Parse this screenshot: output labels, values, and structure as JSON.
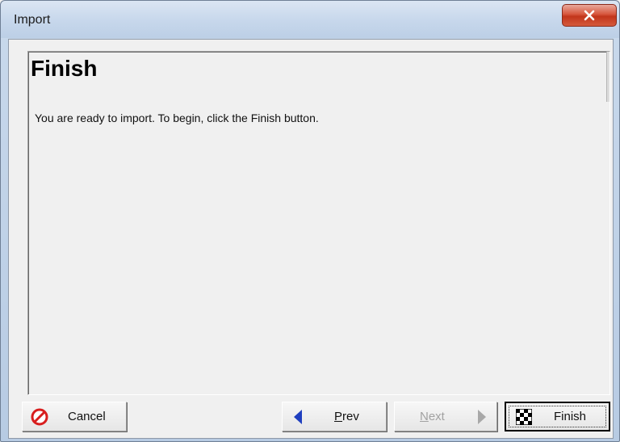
{
  "window": {
    "title": "Import"
  },
  "page": {
    "title": "Finish",
    "description": "You are ready to import.  To begin, click the Finish button."
  },
  "buttons": {
    "cancel": {
      "label": "Cancel",
      "icon": "cancel-icon"
    },
    "prev": {
      "label": "Prev",
      "icon": "left-arrow-icon",
      "mnemonic": "P",
      "rest": "rev"
    },
    "next": {
      "label": "Next",
      "icon": "right-arrow-icon",
      "mnemonic": "N",
      "rest": "ext",
      "enabled": false
    },
    "finish": {
      "label": "Finish",
      "icon": "checkered-flag-icon",
      "focused": true
    }
  },
  "colors": {
    "close_button": "#d7553c",
    "arrow_blue": "#1f3fbf",
    "cancel_red": "#d81e1e",
    "disabled_text": "#a2a2a2"
  }
}
